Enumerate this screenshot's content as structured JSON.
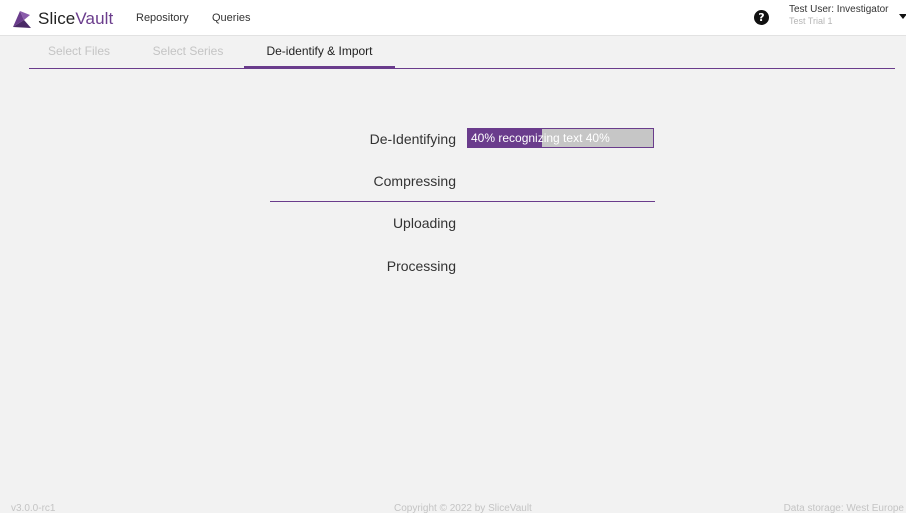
{
  "app": {
    "brand_part1": "Slice",
    "brand_part2": "Vault",
    "brand_color": "#6a3c8c"
  },
  "nav": {
    "items": [
      {
        "label": "Repository"
      },
      {
        "label": "Queries"
      }
    ]
  },
  "header": {
    "help_icon": "question-circle-icon",
    "help_glyph": "?",
    "user_name": "Test User: Investigator",
    "user_trial": "Test Trial 1",
    "user_menu_icon": "caret-down-icon"
  },
  "tabs": [
    {
      "label": "Select Files",
      "state": "disabled"
    },
    {
      "label": "Select Series",
      "state": "disabled"
    },
    {
      "label": "De-identify & Import",
      "state": "active"
    }
  ],
  "steps": [
    {
      "label": "De-Identifying"
    },
    {
      "label": "Compressing"
    },
    {
      "label": "Uploading"
    },
    {
      "label": "Processing"
    }
  ],
  "progress": {
    "text": "40% recognizing text 40%",
    "percent": 40,
    "fill_color": "#6a3c8c",
    "track_color": "#c6c6c6"
  },
  "footer": {
    "version": "v3.0.0-rc1",
    "copyright": "Copyright © 2022 by SliceVault",
    "storage": "Data storage: West Europe"
  }
}
